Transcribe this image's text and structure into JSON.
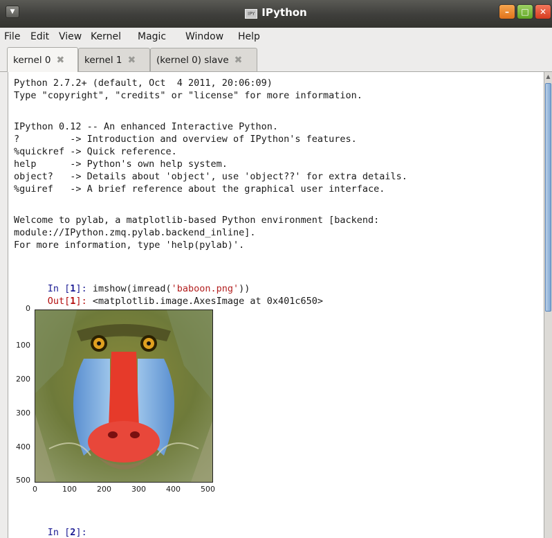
{
  "window": {
    "title": "IPython",
    "app_icon_text": "IPY",
    "buttons": {
      "minimize": "–",
      "maximize": "□",
      "close": "✕"
    }
  },
  "menu": [
    "File",
    "Edit",
    "View",
    "Kernel",
    "Magic",
    "Window",
    "Help"
  ],
  "tabs": [
    {
      "label": "kernel 0",
      "active": true
    },
    {
      "label": "kernel 1",
      "active": false
    },
    {
      "label": "(kernel 0) slave",
      "active": false
    }
  ],
  "console": {
    "lines": [
      "Python 2.7.2+ (default, Oct  4 2011, 20:06:09)",
      "Type \"copyright\", \"credits\" or \"license\" for more information.",
      "",
      "IPython 0.12 -- An enhanced Interactive Python.",
      "?         -> Introduction and overview of IPython's features.",
      "%quickref -> Quick reference.",
      "help      -> Python's own help system.",
      "object?   -> Details about 'object', use 'object??' for extra details.",
      "%guiref   -> A brief reference about the graphical user interface.",
      "",
      "Welcome to pylab, a matplotlib-based Python environment [backend:",
      "module://IPython.zmq.pylab.backend_inline].",
      "For more information, type 'help(pylab)'."
    ],
    "in1_prompt": "In [",
    "in1_num": "1",
    "in1_close": "]: ",
    "in1_code_pre": "imshow(imread(",
    "in1_code_str": "'baboon.png'",
    "in1_code_post": "))",
    "out1_prompt": "Out[",
    "out1_num": "1",
    "out1_close": "]: ",
    "out1_text": "<matplotlib.image.AxesImage at 0x401c650>",
    "in2_prompt": "In [",
    "in2_num": "2",
    "in2_close": "]:"
  },
  "plot": {
    "y_ticks": [
      "0",
      "100",
      "200",
      "300",
      "400",
      "500"
    ],
    "x_ticks": [
      "0",
      "100",
      "200",
      "300",
      "400",
      "500"
    ],
    "image_description_name": "baboon-image"
  }
}
